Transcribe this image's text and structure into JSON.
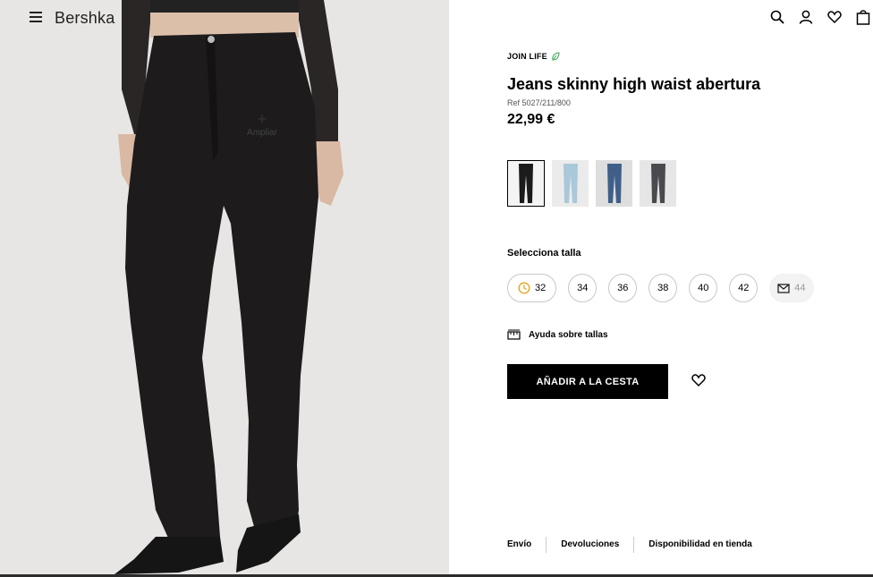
{
  "header": {
    "logo": "Bershka",
    "icons": [
      "menu-icon",
      "search-icon",
      "user-icon",
      "heart-icon",
      "bag-icon"
    ]
  },
  "image": {
    "zoom_label": "Ampliar",
    "zoom_symbol": "+"
  },
  "product": {
    "badge": "JOIN LIFE",
    "title": "Jeans skinny high waist abertura",
    "ref": "Ref 5027/211/800",
    "price": "22,99 €"
  },
  "colors": [
    {
      "name": "black",
      "hex": "#1b1b1b",
      "selected": true
    },
    {
      "name": "light-blue",
      "hex": "#a9c8da",
      "selected": false
    },
    {
      "name": "mid-blue",
      "hex": "#3f5f8a",
      "selected": false
    },
    {
      "name": "grey",
      "hex": "#4a4a4e",
      "selected": false
    }
  ],
  "sizes": {
    "label": "Selecciona talla",
    "options": [
      {
        "value": "32",
        "icon": "clock-icon",
        "available": true
      },
      {
        "value": "34",
        "available": true
      },
      {
        "value": "36",
        "available": true
      },
      {
        "value": "38",
        "available": true
      },
      {
        "value": "40",
        "available": true
      },
      {
        "value": "42",
        "available": true
      },
      {
        "value": "44",
        "icon": "mail-icon",
        "available": false
      }
    ]
  },
  "help": {
    "label": "Ayuda sobre tallas"
  },
  "cta": {
    "add_label": "AÑADIR A LA CESTA"
  },
  "footer": {
    "links": [
      "Envío",
      "Devoluciones",
      "Disponibilidad en tienda"
    ]
  },
  "theme": {
    "accent": "#000000",
    "leaf": "#3aa655"
  }
}
